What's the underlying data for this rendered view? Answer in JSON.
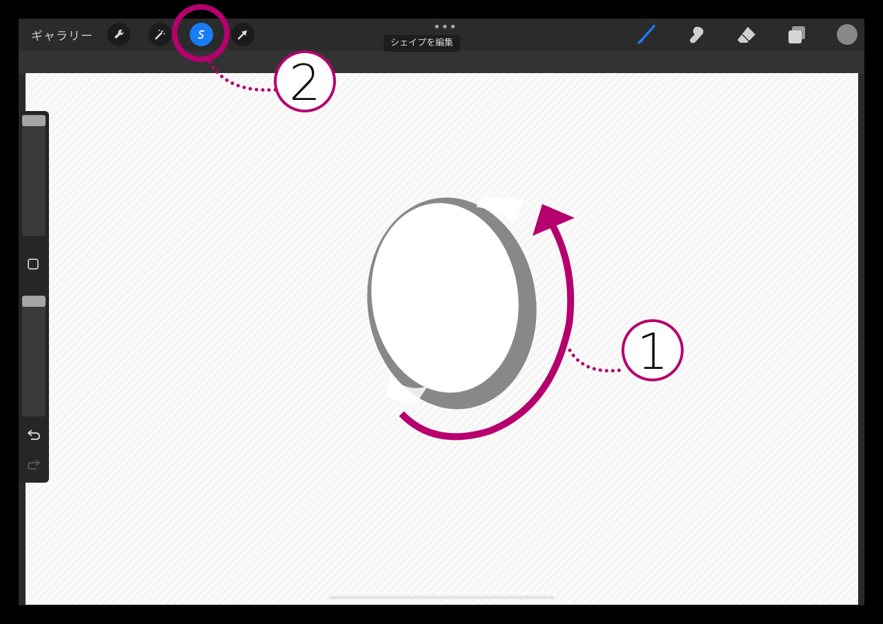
{
  "toolbar": {
    "gallery_label": "ギャラリー",
    "more_dots": "•••",
    "tools": [
      {
        "name": "actions",
        "icon": "wrench-icon"
      },
      {
        "name": "adjustments",
        "icon": "magic-wand-icon"
      },
      {
        "name": "selection",
        "icon": "selection-s-icon",
        "active": true
      },
      {
        "name": "transform",
        "icon": "arrow-cursor-icon"
      }
    ],
    "right_tools": [
      "brush-icon",
      "smudge-icon",
      "eraser-icon",
      "layers-icon"
    ],
    "active_color": "#888888",
    "accent_color": "#1a7cf5"
  },
  "tooltip": {
    "text": "シェイプを編集"
  },
  "annotations": {
    "marker_1": "1",
    "marker_2": "2",
    "color": "#b5006e"
  },
  "sidebar": {
    "icons": [
      "square-icon",
      "undo-icon",
      "redo-icon"
    ]
  }
}
